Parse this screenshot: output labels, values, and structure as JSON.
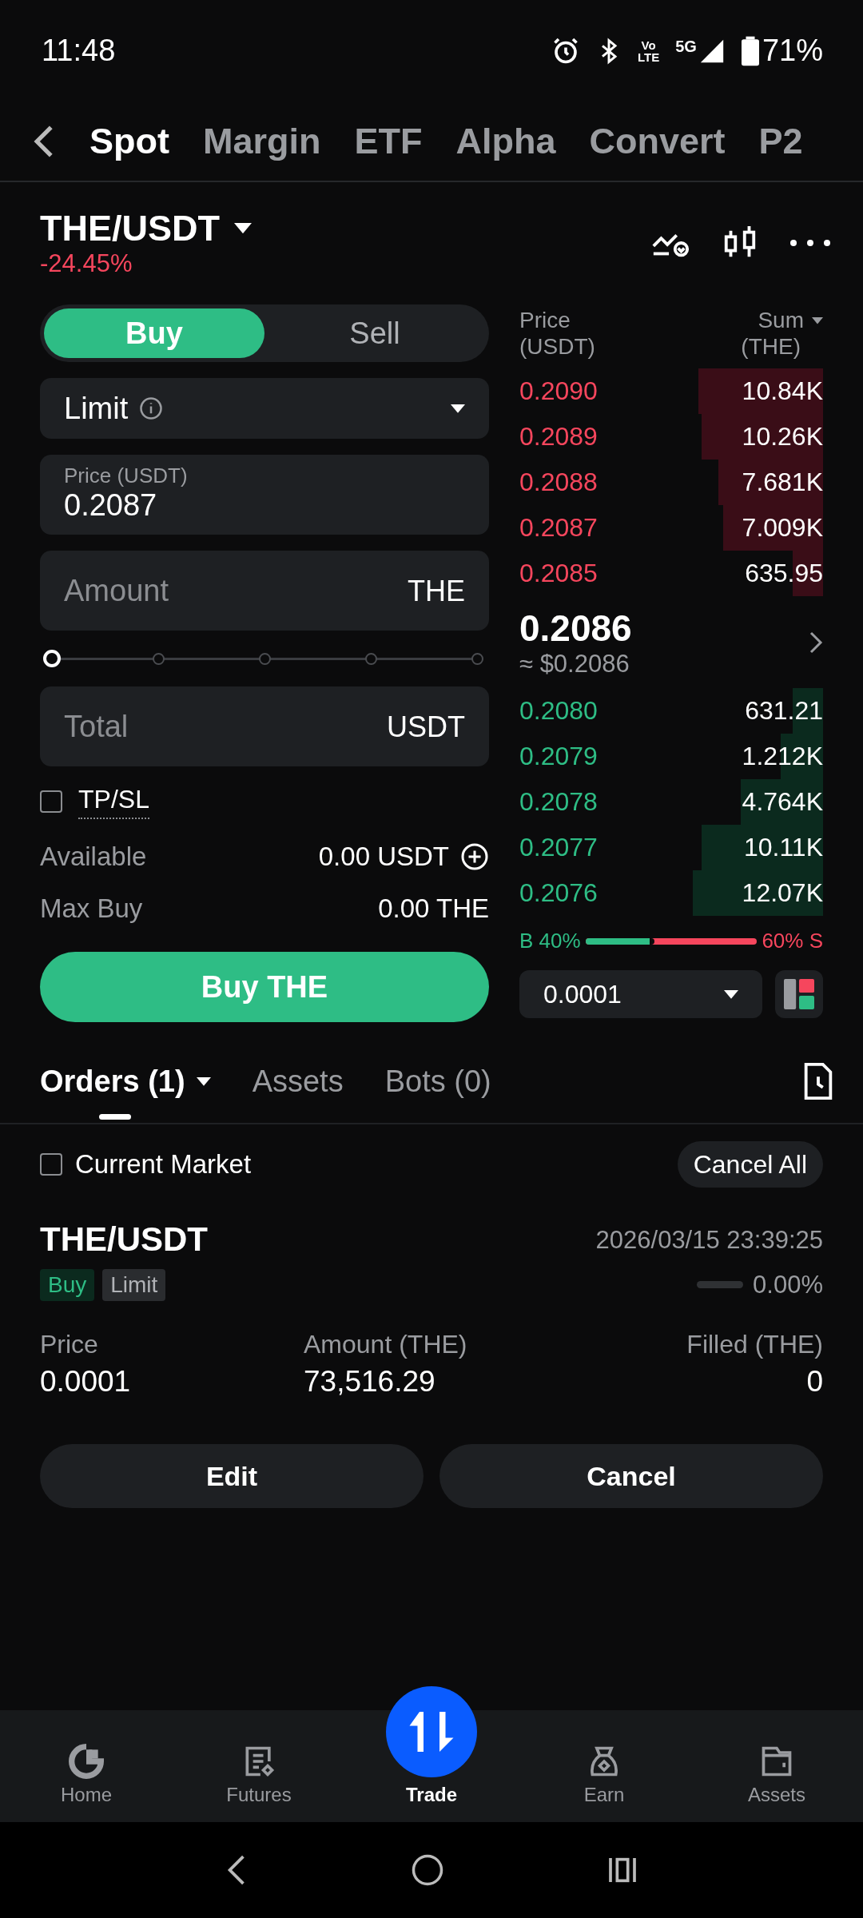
{
  "status_bar": {
    "time": "11:48",
    "volte": [
      "Vo",
      "LTE"
    ],
    "network": "5G",
    "battery": "71%"
  },
  "nav_tabs": [
    {
      "label": "Spot",
      "selected": true
    },
    {
      "label": "Margin",
      "selected": false
    },
    {
      "label": "ETF",
      "selected": false
    },
    {
      "label": "Alpha",
      "selected": false
    },
    {
      "label": "Convert",
      "selected": false
    },
    {
      "label": "P2",
      "selected": false
    }
  ],
  "pair": {
    "symbol": "THE/USDT",
    "change": "-24.45%"
  },
  "order_form": {
    "sides": [
      {
        "label": "Buy",
        "selected": true
      },
      {
        "label": "Sell",
        "selected": false
      }
    ],
    "order_type": "Limit",
    "price": {
      "label": "Price (USDT)",
      "value": "0.2087"
    },
    "amount": {
      "placeholder": "Amount",
      "unit": "THE"
    },
    "slider": {
      "level": 0
    },
    "total": {
      "placeholder": "Total",
      "unit": "USDT"
    },
    "tpsl": {
      "label": "TP/SL",
      "checked": false
    },
    "available": {
      "label": "Available",
      "value": "0.00 USDT"
    },
    "max_buy": {
      "label": "Max Buy",
      "value": "0.00 THE"
    },
    "submit": "Buy THE"
  },
  "order_book": {
    "price_header": [
      "Price",
      "(USDT)"
    ],
    "sum_header": [
      "Sum",
      "(THE)"
    ],
    "asks": [
      {
        "price": "0.2090",
        "sum": "10.84K"
      },
      {
        "price": "0.2089",
        "sum": "10.26K"
      },
      {
        "price": "0.2088",
        "sum": "7.681K"
      },
      {
        "price": "0.2087",
        "sum": "7.009K"
      },
      {
        "price": "0.2085",
        "sum": "635.95"
      }
    ],
    "last_price": "0.2086",
    "last_price_usd": "≈ $0.2086",
    "bids": [
      {
        "price": "0.2080",
        "sum": "631.21"
      },
      {
        "price": "0.2079",
        "sum": "1.212K"
      },
      {
        "price": "0.2078",
        "sum": "4.764K"
      },
      {
        "price": "0.2077",
        "sum": "10.11K"
      },
      {
        "price": "0.2076",
        "sum": "12.07K"
      }
    ],
    "ratio": {
      "buy_label": "B 40%",
      "sell_label": "60% S",
      "level": 0.4
    },
    "precision": "0.0001"
  },
  "orders_tabs": [
    {
      "label": "Orders (1)",
      "selected": true
    },
    {
      "label": "Assets",
      "selected": false
    },
    {
      "label": "Bots (0)",
      "selected": false
    }
  ],
  "current_market": {
    "label": "Current Market",
    "checked": false
  },
  "cancel_all": "Cancel All",
  "orders": [
    {
      "pair": "THE/USDT",
      "time": "2026/03/15 23:39:25",
      "side": "Buy",
      "type": "Limit",
      "filled_pct": "0.00%",
      "fields": [
        {
          "label": "Price",
          "value": "0.0001"
        },
        {
          "label": "Amount (THE)",
          "value": "73,516.29"
        },
        {
          "label": "Filled (THE)",
          "value": "0"
        }
      ],
      "actions": [
        "Edit",
        "Cancel"
      ]
    }
  ],
  "bottom_nav": [
    {
      "label": "Home",
      "kind": "home",
      "selected": false
    },
    {
      "label": "Futures",
      "kind": "futures",
      "selected": false
    },
    {
      "label": "Trade",
      "kind": "trade",
      "selected": true
    },
    {
      "label": "Earn",
      "kind": "earn",
      "selected": false
    },
    {
      "label": "Assets",
      "kind": "assets",
      "selected": false
    }
  ]
}
